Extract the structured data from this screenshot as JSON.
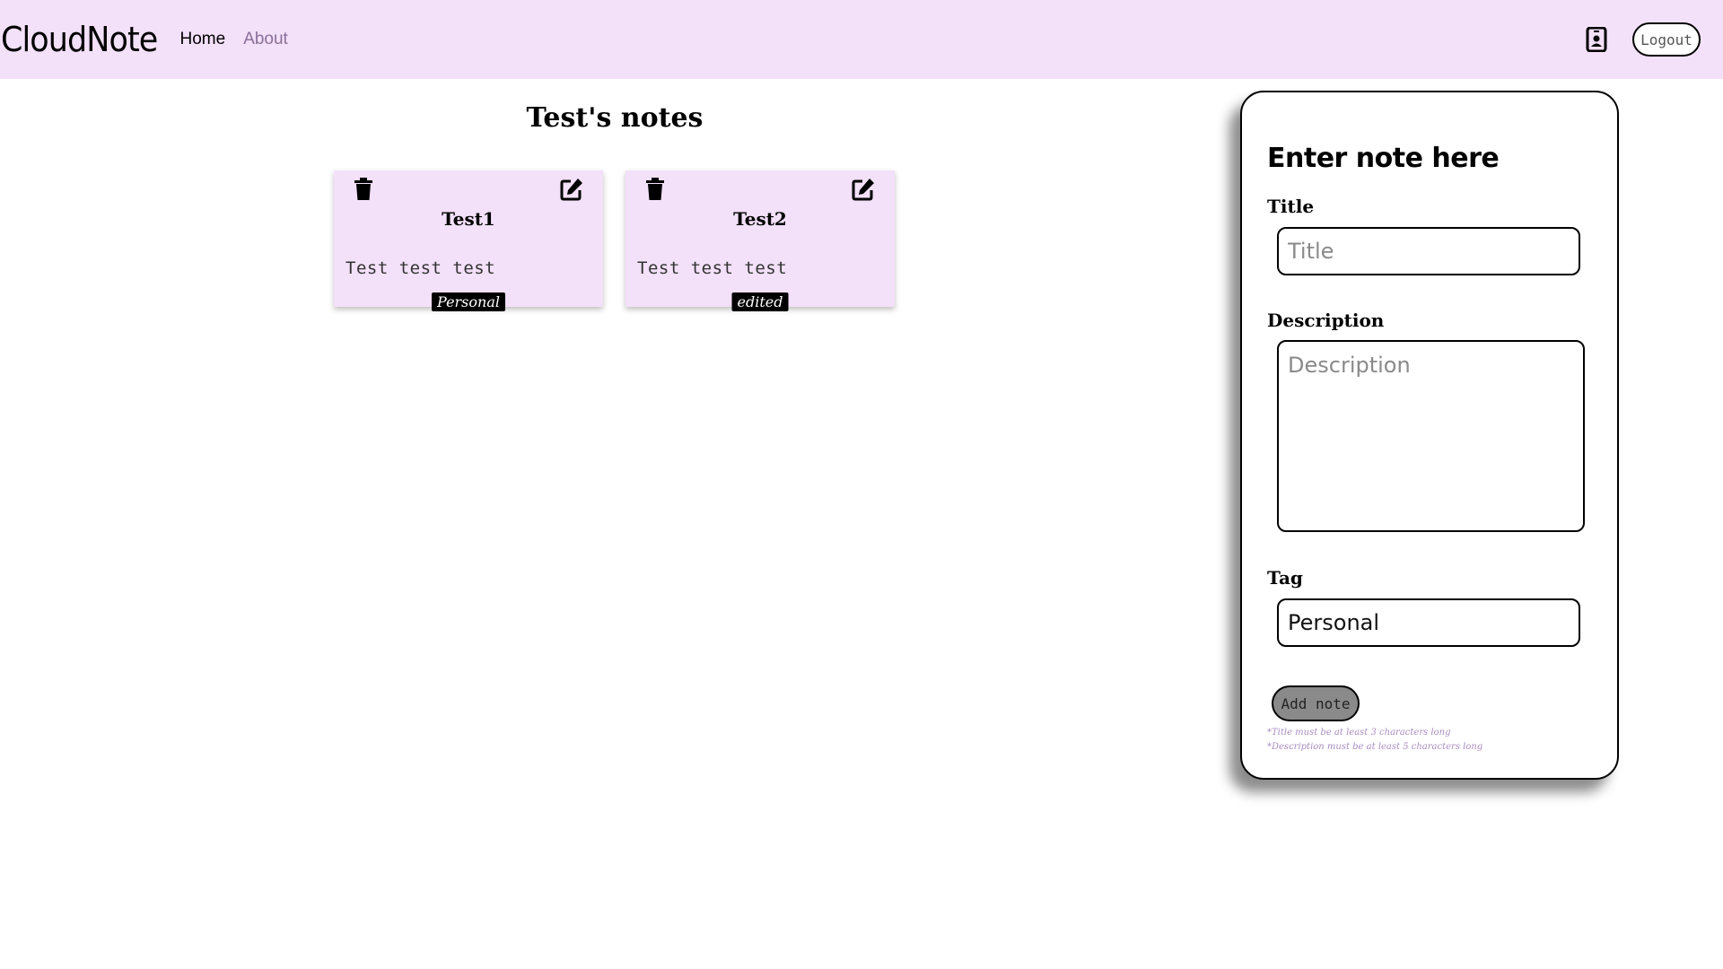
{
  "navbar": {
    "brand": "CloudNote",
    "links": [
      "Home",
      "About"
    ],
    "profile_icon": "profile-icon",
    "logout_label": "Logout",
    "bg_color": "#f3e0f9"
  },
  "main": {
    "heading": "Test's notes",
    "notes": [
      {
        "title": "Test1",
        "description": "Test test test",
        "tag": "Personal"
      },
      {
        "title": "Test2",
        "description": "Test test test",
        "tag": "edited"
      }
    ]
  },
  "form": {
    "heading": "Enter note here",
    "title_label": "Title",
    "title_placeholder": "Title",
    "description_label": "Description",
    "description_placeholder": "Description",
    "tag_label": "Tag",
    "tag_value": "Personal",
    "submit_label": "Add note",
    "hints": [
      "*Title must be at least 3 characters long",
      "*Description must be at least 5 characters long"
    ]
  }
}
